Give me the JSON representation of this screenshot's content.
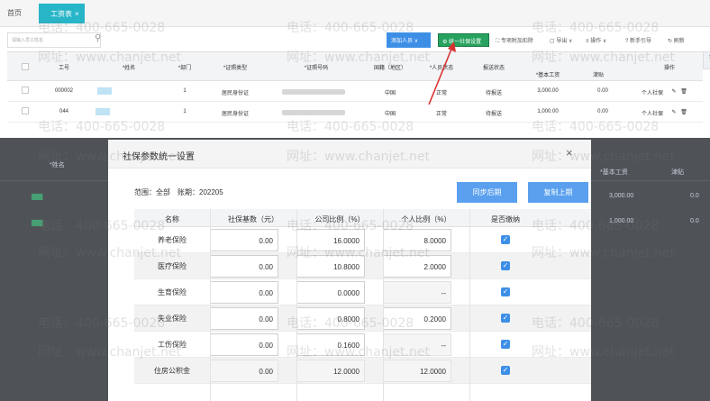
{
  "tabs": {
    "home": "首页",
    "active": "工资表",
    "close": "×"
  },
  "toolbar": {
    "search_placeholder": "请输入员工姓名",
    "add_label": "添加人员 ∨",
    "unify_label": "统一社保设置",
    "tools": [
      "专项附加扣除",
      "导出 ∨",
      "操作 ∨",
      "新手引导",
      "刷新"
    ]
  },
  "table": {
    "headers": [
      "工号",
      "*姓名",
      "*部门",
      "*证照类型",
      "*证照号码",
      "国籍（地区）",
      "*人员状态",
      "报送状态",
      "*基本工资",
      "津贴",
      "操作"
    ],
    "rows": [
      {
        "id": "000002",
        "dept": "1",
        "idtype": "居民身份证",
        "nation": "中国",
        "status": "正常",
        "report": "待报送",
        "salary": "3,000.00",
        "allowance": "0.00",
        "op": "个人社保"
      },
      {
        "id": "044",
        "dept": "1",
        "idtype": "居民身份证",
        "nation": "中国",
        "status": "正常",
        "report": "待报送",
        "salary": "1,000.00",
        "allowance": "0.00",
        "op": "个人社保"
      }
    ]
  },
  "overlay": {
    "name_header": "*姓名",
    "salary_header": "*基本工资",
    "allowance_header": "津贴",
    "values": [
      "3,000.00",
      "1,000.00"
    ],
    "allowance_values": [
      "0.0",
      "0.0"
    ]
  },
  "modal": {
    "title": "社保参数统一设置",
    "close": "×",
    "scope": "范围：全部　账期：202205",
    "sync_button": "同步后期",
    "copy_button": "复制上期",
    "headers": [
      "名称",
      "社保基数（元）",
      "公司比例（%）",
      "个人比例（%）",
      "是否缴纳"
    ],
    "rows": [
      {
        "name": "养老保险",
        "base": "0.00",
        "company": "16.0000",
        "personal": "8.0000",
        "paid": true
      },
      {
        "name": "医疗保险",
        "base": "0.00",
        "company": "10.8000",
        "personal": "2.0000",
        "paid": true
      },
      {
        "name": "生育保险",
        "base": "0.00",
        "company": "0.0000",
        "personal": "--",
        "paid": true
      },
      {
        "name": "失业保险",
        "base": "0.00",
        "company": "0.8000",
        "personal": "0.2000",
        "paid": true
      },
      {
        "name": "工伤保险",
        "base": "0.00",
        "company": "0.1600",
        "personal": "--",
        "paid": true
      },
      {
        "name": "住房公积金",
        "base": "0.00",
        "company": "12.0000",
        "personal": "12.0000",
        "paid": true
      }
    ]
  },
  "watermark": {
    "phone": "电话：400-665-0028",
    "site": "网址：www.chanjet.net"
  },
  "colors": {
    "accent": "#28b5c8",
    "primary": "#3d8fe6",
    "success": "#27a35f",
    "arrow": "#d93030"
  }
}
